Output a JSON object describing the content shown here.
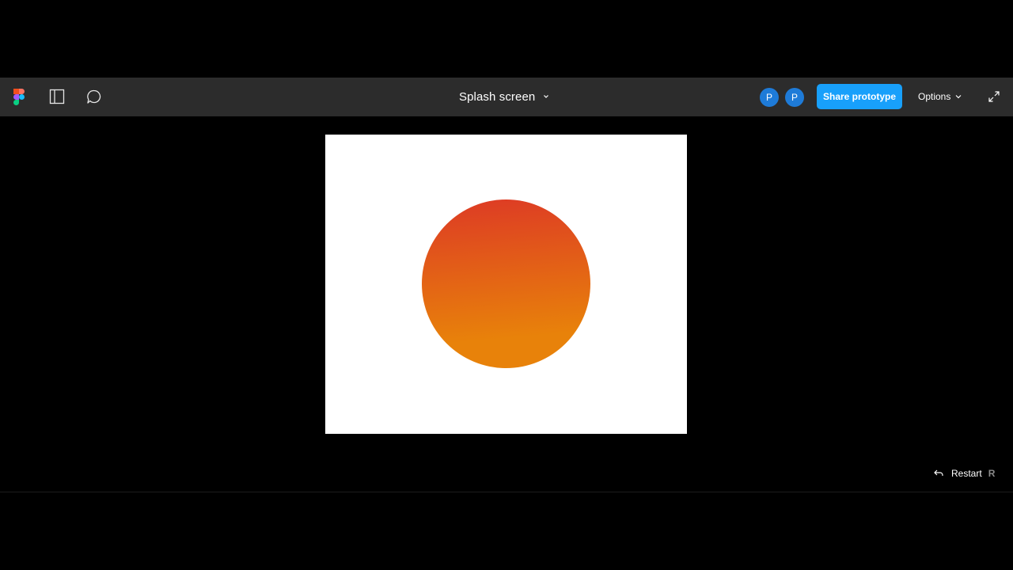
{
  "toolbar": {
    "title": "Splash screen",
    "avatars": [
      "P",
      "P"
    ],
    "share_label": "Share prototype",
    "options_label": "Options"
  },
  "icons": {
    "logo": "figma-logo-icon",
    "panel": "sidebar-panel-icon",
    "comment": "comment-bubble-icon",
    "title_dropdown": "chevron-down-icon",
    "options_dropdown": "chevron-down-icon",
    "fullscreen": "expand-icon",
    "restart": "undo-arrow-icon"
  },
  "footer": {
    "restart_label": "Restart",
    "restart_shortcut": "R"
  },
  "colors": {
    "toolbar_bg": "#2c2c2c",
    "canvas_bg": "#000000",
    "accent": "#18a0fb",
    "avatar": "#1e7bd8",
    "sun_top": "#dd3a25",
    "sun_bottom": "#e8820a"
  }
}
